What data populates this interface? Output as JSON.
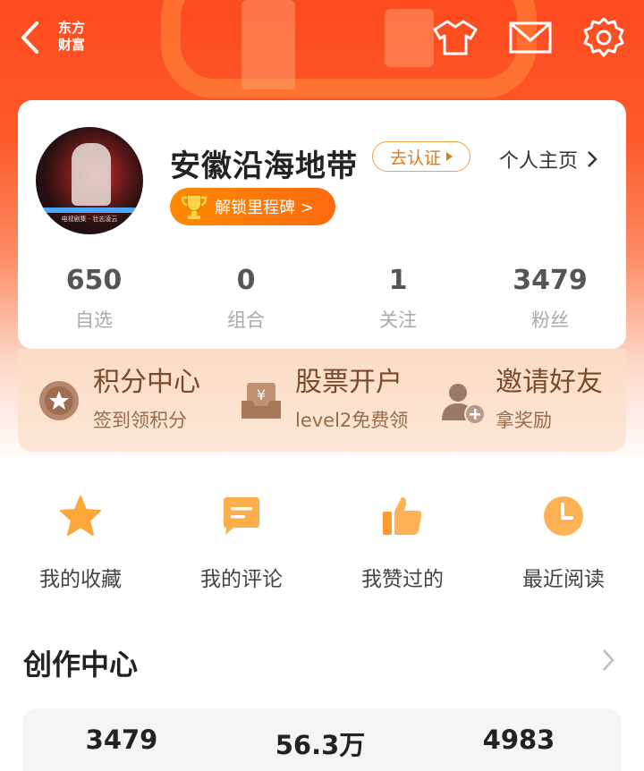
{
  "topbar": {
    "logo_line1": "东方",
    "logo_line2": "财富",
    "icons": [
      "back-icon",
      "tshirt-icon",
      "mail-icon",
      "settings-icon"
    ]
  },
  "profile": {
    "avatar_caption": "电视剧集 · 壮志凌云",
    "username": "安徽沿海地带",
    "verify_label": "去认证",
    "homepage_label": "个人主页",
    "milestone_label": "解锁里程碑 >",
    "stats": [
      {
        "value": "650",
        "label": "自选"
      },
      {
        "value": "0",
        "label": "组合"
      },
      {
        "value": "1",
        "label": "关注"
      },
      {
        "value": "3479",
        "label": "粉丝"
      }
    ]
  },
  "promo": [
    {
      "title": "积分中心",
      "sub": "签到领积分",
      "icon": "star-badge-icon"
    },
    {
      "title": "股票开户",
      "sub": "level2免费领",
      "icon": "yuan-box-icon"
    },
    {
      "title": "邀请好友",
      "sub": "拿奖励",
      "icon": "add-user-icon"
    }
  ],
  "quick_actions": [
    {
      "label": "我的收藏",
      "icon": "star-icon"
    },
    {
      "label": "我的评论",
      "icon": "comment-icon"
    },
    {
      "label": "我赞过的",
      "icon": "thumbs-up-icon"
    },
    {
      "label": "最近阅读",
      "icon": "clock-icon"
    }
  ],
  "creator": {
    "title": "创作中心",
    "stats": [
      "3479",
      "56.3万",
      "4983"
    ]
  },
  "colors": {
    "brand": "#fe4a1f",
    "accent_orange": "#fd8a1a",
    "promo_text": "#7a4a2a"
  }
}
